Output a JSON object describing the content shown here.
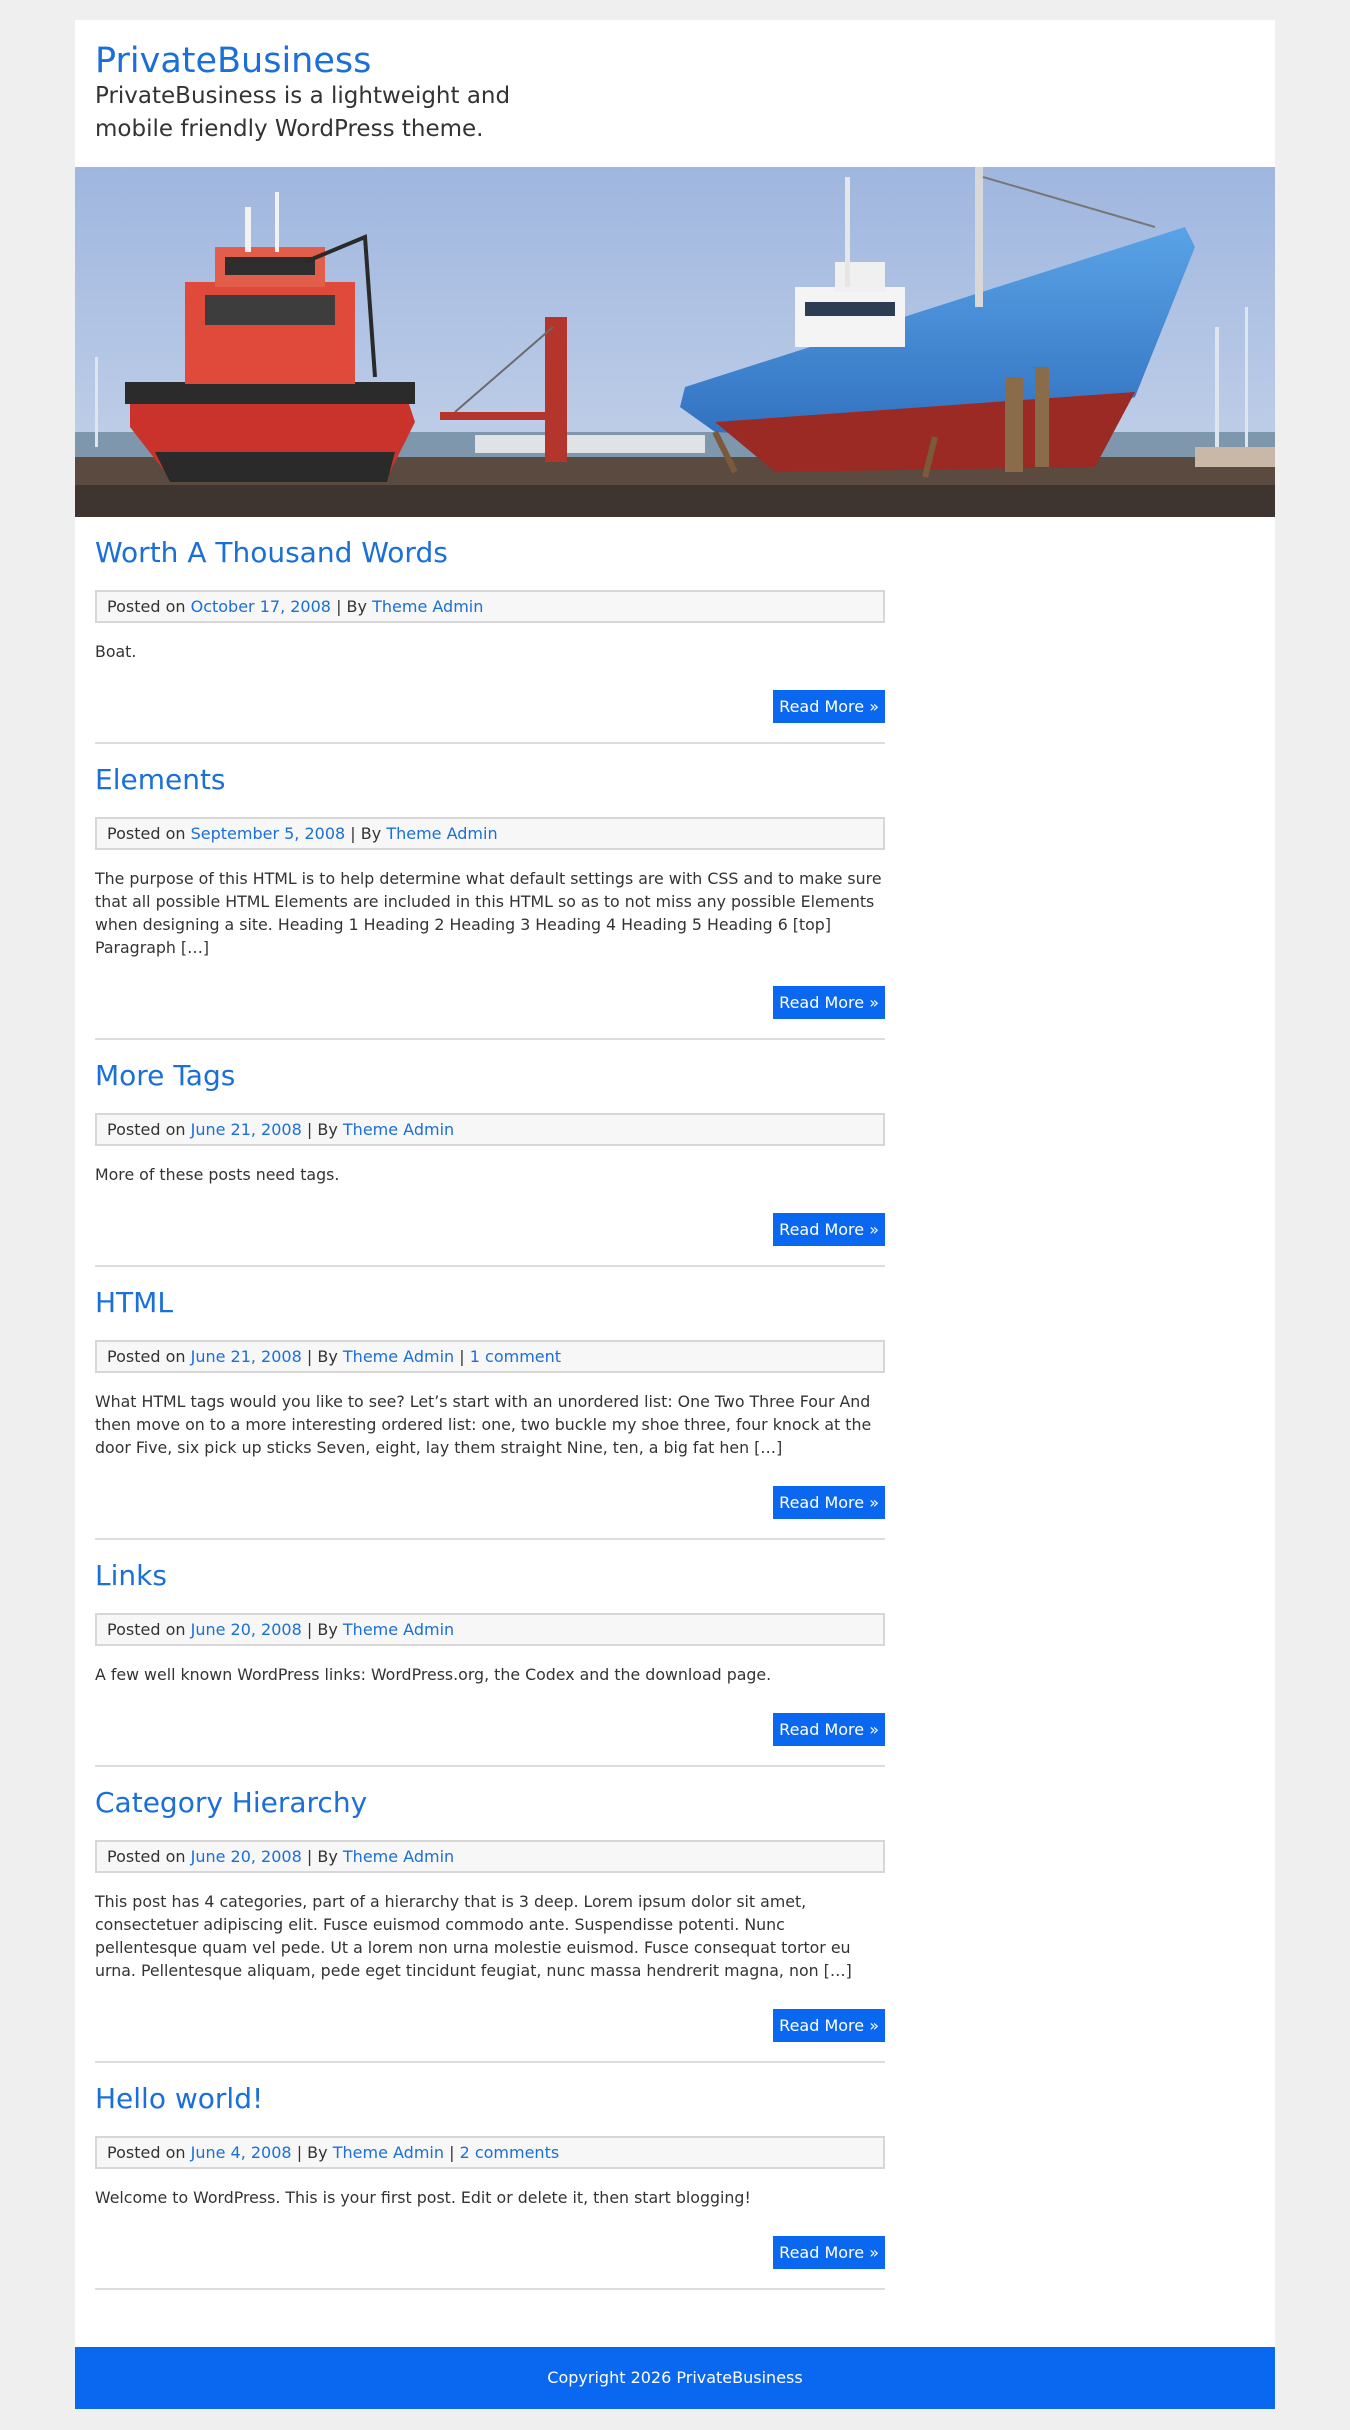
{
  "site": {
    "title": "PrivateBusiness",
    "description": "PrivateBusiness is a lightweight and mobile friendly WordPress theme."
  },
  "labels": {
    "posted_on": "Posted on",
    "by": "By",
    "separator": "|",
    "read_more": "Read More »"
  },
  "posts": [
    {
      "title": "Worth A Thousand Words",
      "date": "October 17, 2008",
      "author": "Theme Admin",
      "comments": "",
      "excerpt": "Boat."
    },
    {
      "title": "Elements",
      "date": "September 5, 2008",
      "author": "Theme Admin",
      "comments": "",
      "excerpt": "The purpose of this HTML is to help determine what default settings are with CSS and to make sure that all possible HTML Elements are included in this HTML so as to not miss any possible Elements when designing a site. Heading 1 Heading 2 Heading 3 Heading 4 Heading 5 Heading 6 [top] Paragraph […]"
    },
    {
      "title": "More Tags",
      "date": "June 21, 2008",
      "author": "Theme Admin",
      "comments": "",
      "excerpt": "More of these posts need tags."
    },
    {
      "title": "HTML",
      "date": "June 21, 2008",
      "author": "Theme Admin",
      "comments": "1 comment",
      "excerpt": "What HTML tags would you like to see? Let’s start with an unordered list: One Two Three Four And then move on to a more interesting ordered list: one, two buckle my shoe three, four knock at the door Five, six pick up sticks Seven, eight, lay them straight Nine, ten, a big fat hen […]"
    },
    {
      "title": "Links",
      "date": "June 20, 2008",
      "author": "Theme Admin",
      "comments": "",
      "excerpt": "A few well known WordPress links: WordPress.org, the Codex and the download page."
    },
    {
      "title": "Category Hierarchy",
      "date": "June 20, 2008",
      "author": "Theme Admin",
      "comments": "",
      "excerpt": "This post has 4 categories, part of a hierarchy that is 3 deep. Lorem ipsum dolor sit amet, consectetuer adipiscing elit. Fusce euismod commodo ante. Suspendisse potenti. Nunc pellentesque quam vel pede. Ut a lorem non urna molestie euismod. Fusce consequat tortor eu urna. Pellentesque aliquam, pede eget tincidunt feugiat, nunc massa hendrerit magna, non […]"
    },
    {
      "title": "Hello world!",
      "date": "June 4, 2008",
      "author": "Theme Admin",
      "comments": "2 comments",
      "excerpt": "Welcome to WordPress. This is your first post. Edit or delete it, then start blogging!"
    }
  ],
  "footer": {
    "copyright": "Copyright 2026 PrivateBusiness"
  },
  "colors": {
    "link": "#1a6fd8",
    "accent": "#0a67f0",
    "page_background": "#efefef",
    "meta_background": "#f7f7f7"
  }
}
